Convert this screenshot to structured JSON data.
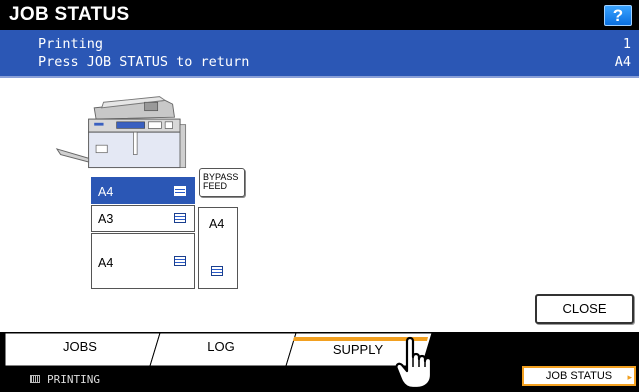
{
  "header": {
    "title": "JOB STATUS",
    "help_label": "?"
  },
  "message": {
    "line1": "Printing",
    "line2": "Press JOB STATUS to return",
    "right1": "1",
    "right2": "A4"
  },
  "supply": {
    "drawers": [
      {
        "label": "A4",
        "selected": true
      },
      {
        "label": "A3",
        "selected": false
      },
      {
        "label": "A4",
        "selected": false
      }
    ],
    "bypass_button_line1": "BYPASS",
    "bypass_button_line2": "FEED",
    "bypass_tray_label": "A4",
    "paper_icon": "paper-stack-icon"
  },
  "buttons": {
    "close_label": "CLOSE"
  },
  "tabs": [
    {
      "label": "JOBS",
      "active": false
    },
    {
      "label": "LOG",
      "active": false
    },
    {
      "label": "SUPPLY",
      "active": true
    }
  ],
  "status": {
    "text": "PRINTING",
    "icon": "printer-icon",
    "job_status_label": "JOB STATUS"
  },
  "colors": {
    "title_bg": "#000000",
    "message_bg": "#2b57b5",
    "help_bg": "#0a6fe0",
    "active_tab_accent": "#f2a020",
    "selected_drawer": "#2b57b5"
  },
  "pointer_icon": "hand-pointer-icon"
}
